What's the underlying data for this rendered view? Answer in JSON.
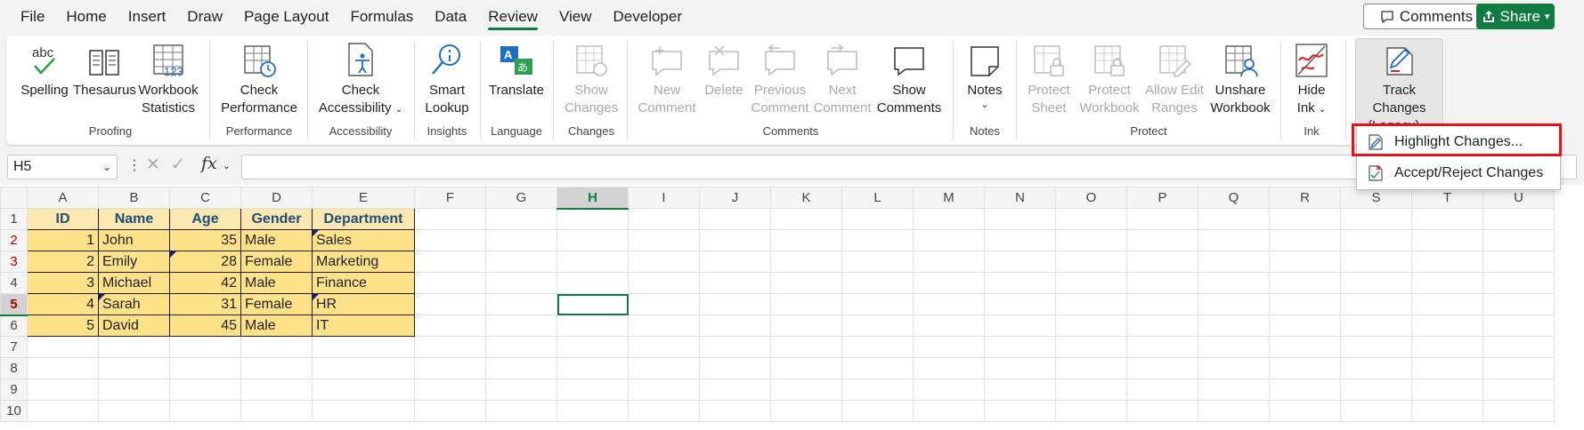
{
  "menu": {
    "tabs": [
      "File",
      "Home",
      "Insert",
      "Draw",
      "Page Layout",
      "Formulas",
      "Data",
      "Review",
      "View",
      "Developer"
    ],
    "active_tab": "Review",
    "comments_label": "Comments",
    "share_label": "Share"
  },
  "ribbon": {
    "spelling": "Spelling",
    "thesaurus": "Thesaurus",
    "workbook": "Workbook",
    "statistics": "Statistics",
    "group_proofing": "Proofing",
    "check1": "Check",
    "performance": "Performance",
    "group_performance": "Performance",
    "check2": "Check",
    "accessibility": "Accessibility",
    "group_accessibility": "Accessibility",
    "smart": "Smart",
    "lookup": "Lookup",
    "group_insights": "Insights",
    "translate": "Translate",
    "group_language": "Language",
    "show1": "Show",
    "changes": "Changes",
    "group_changes": "Changes",
    "new": "New",
    "comment1": "Comment",
    "delete": "Delete",
    "previous": "Previous",
    "comment2": "Comment",
    "next": "Next",
    "comment3": "Comment",
    "show2": "Show",
    "comments": "Comments",
    "group_comments": "Comments",
    "notes": "Notes",
    "group_notes": "Notes",
    "protect1": "Protect",
    "sheet": "Sheet",
    "protect2": "Protect",
    "workbook2": "Workbook",
    "allow_edit": "Allow Edit",
    "ranges": "Ranges",
    "unshare": "Unshare",
    "workbook3": "Workbook",
    "group_protect": "Protect",
    "hide": "Hide",
    "ink": "Ink",
    "group_ink": "Ink",
    "track_changes": "Track Changes",
    "legacy": "(Legacy)"
  },
  "formula_bar": {
    "name_box": "H5",
    "fx": "fx",
    "formula": ""
  },
  "sheet": {
    "columns": [
      "A",
      "B",
      "C",
      "D",
      "E",
      "F",
      "G",
      "H",
      "I",
      "J",
      "K",
      "L",
      "M",
      "N",
      "O",
      "P",
      "Q",
      "R",
      "S",
      "T",
      "U"
    ],
    "selected_column": "H",
    "selected_row": "5",
    "rows": [
      "1",
      "2",
      "3",
      "4",
      "5",
      "6",
      "7",
      "8",
      "9",
      "10"
    ],
    "header": [
      "ID",
      "Name",
      "Age",
      "Gender",
      "Department"
    ],
    "data": [
      [
        "1",
        "John",
        "35",
        "Male",
        "Sales"
      ],
      [
        "2",
        "Emily",
        "28",
        "Female",
        "Marketing"
      ],
      [
        "3",
        "Michael",
        "42",
        "Male",
        "Finance"
      ],
      [
        "4",
        "Sarah",
        "31",
        "Female",
        "HR"
      ],
      [
        "5",
        "David",
        "45",
        "Male",
        "IT"
      ]
    ]
  },
  "dropdown": {
    "items": [
      "Highlight Changes...",
      "Accept/Reject Changes"
    ]
  },
  "colors": {
    "accent": "#107c41",
    "highlight_box": "#e0141c",
    "table_fill": "#fde28a",
    "header_text": "#1f4e79"
  }
}
